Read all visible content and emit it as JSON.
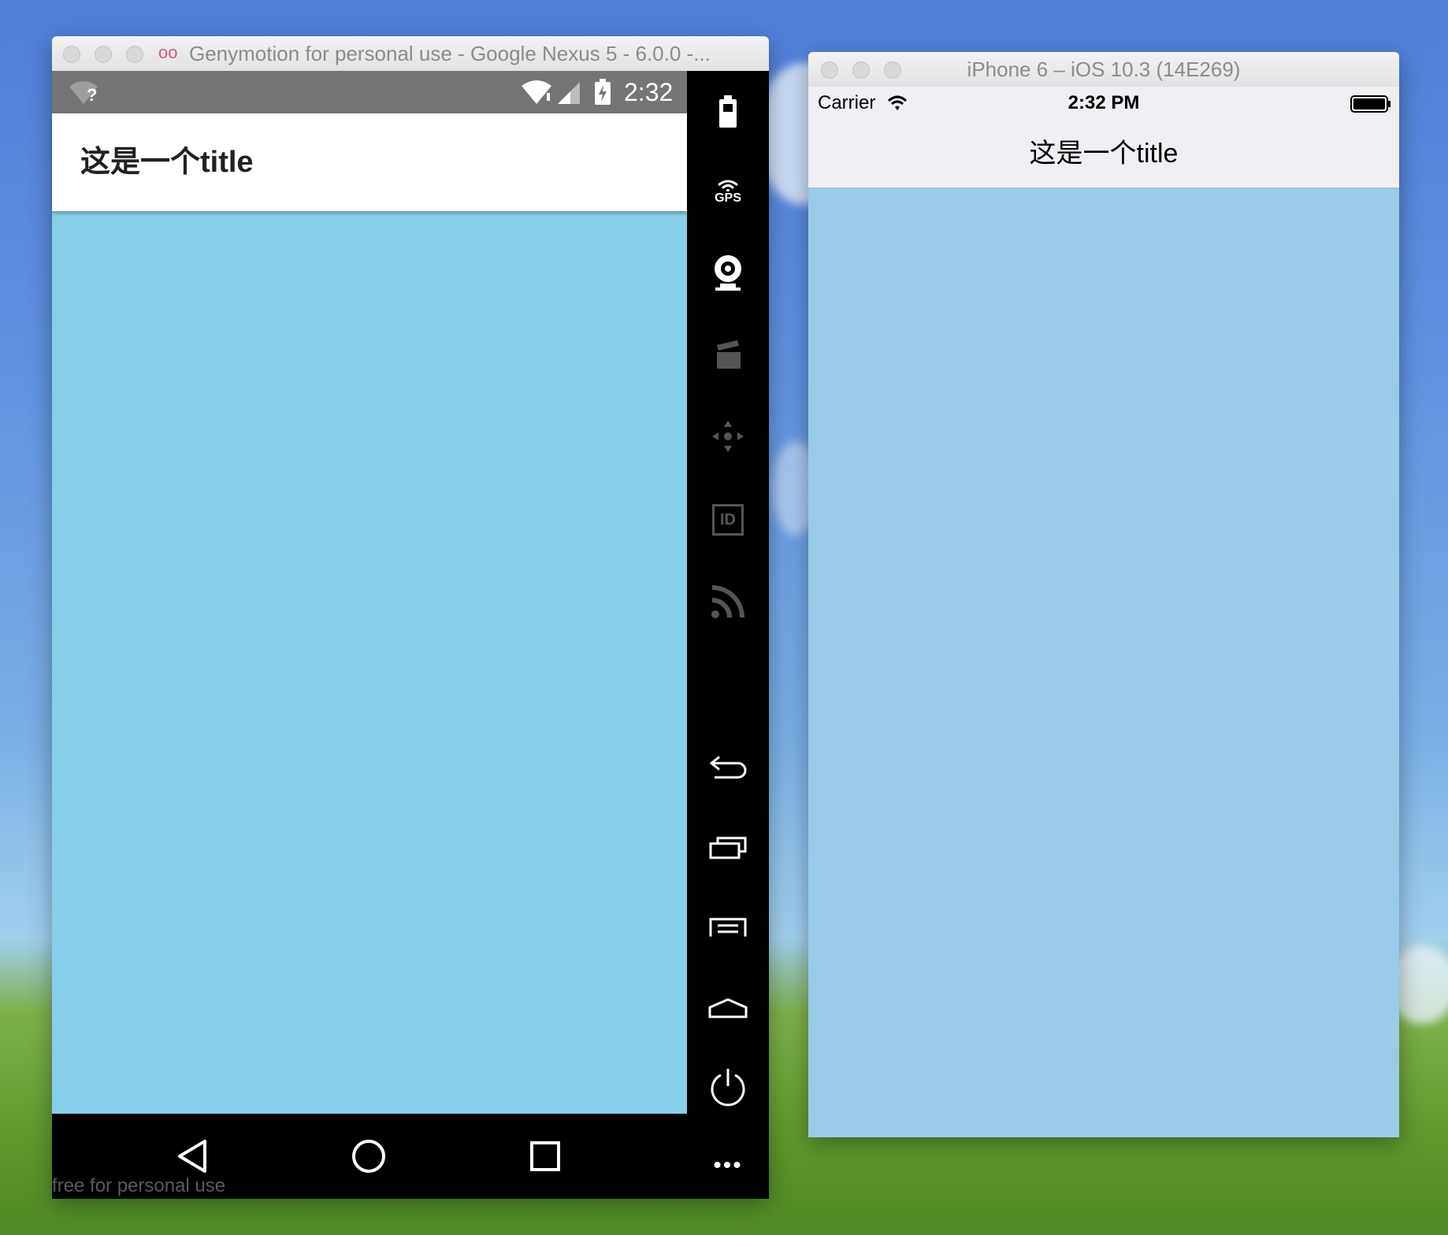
{
  "android": {
    "window_title": "Genymotion for personal use - Google Nexus 5 - 6.0.0 -...",
    "status_time": "2:32",
    "wifi_unknown_mark": "?",
    "toolbar_title": "这是一个title",
    "content_color": "#87ceeb",
    "side_panel": {
      "gps_label": "GPS",
      "id_label": "ID",
      "icons": [
        "battery-icon",
        "gps-icon",
        "camera-icon",
        "video-capture-icon",
        "dpad-icon",
        "device-id-icon",
        "network-icon",
        "back-icon",
        "recent-apps-icon",
        "menu-icon",
        "home-icon",
        "power-icon"
      ]
    },
    "nav_icons": [
      "back-triangle-icon",
      "home-circle-icon",
      "recents-square-icon"
    ],
    "more_label": "•••",
    "watermark": "free for personal use"
  },
  "iphone": {
    "window_title": "iPhone 6 – iOS 10.3 (14E269)",
    "carrier": "Carrier",
    "status_time": "2:32 PM",
    "nav_title": "这是一个title",
    "content_color": "#98cce8"
  }
}
